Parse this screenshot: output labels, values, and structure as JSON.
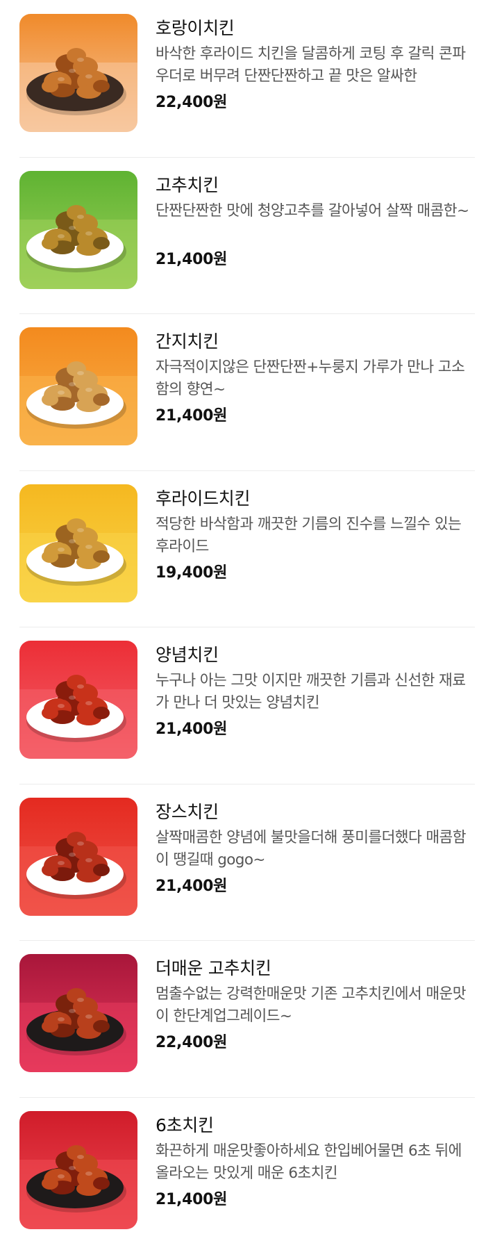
{
  "menu": {
    "items": [
      {
        "name": "호랑이치킨",
        "description": "바삭한 후라이드 치킨을 달콤하게 코팅 후 갈릭 콘파우더로 버무려 단짠단짠하고 끝 맛은 알싸한",
        "price": "22,400원",
        "image": {
          "icon": "chicken-photo",
          "bg_top": "#f08a2a",
          "bg_bottom": "#f7c8a0",
          "plate": "#3a2a22",
          "food": "#c9772e",
          "food_dark": "#9a4d17"
        }
      },
      {
        "name": "고추치킨",
        "description": "단짠단짠한 맛에 청양고추를 갈아넣어 살짝 매콤한~",
        "price": "21,400원",
        "image": {
          "icon": "chicken-photo",
          "bg_top": "#5fb332",
          "bg_bottom": "#9fd05a",
          "plate": "#ffffff",
          "food": "#b98a2c",
          "food_dark": "#7a5a18"
        }
      },
      {
        "name": "간지치킨",
        "description": "자극적이지않은 단짠단짠+누룽지 가루가 만나 고소함의 향연~",
        "price": "21,400원",
        "image": {
          "icon": "chicken-photo",
          "bg_top": "#f38a1e",
          "bg_bottom": "#f9b24a",
          "plate": "#ffffff",
          "food": "#d8a354",
          "food_dark": "#a5682a"
        }
      },
      {
        "name": "후라이드치킨",
        "description": "적당한 바삭함과 깨끗한 기름의 진수를 느낄수 있는 후라이드",
        "price": "19,400원",
        "image": {
          "icon": "chicken-photo",
          "bg_top": "#f5b820",
          "bg_bottom": "#f9d448",
          "plate": "#ffffff",
          "food": "#d19a3a",
          "food_dark": "#9c6420"
        }
      },
      {
        "name": "양념치킨",
        "description": "누구나 아는 그맛 이지만 깨끗한 기름과 신선한 재료가 만나 더 맛있는 양념치킨",
        "price": "21,400원",
        "image": {
          "icon": "chicken-photo",
          "bg_top": "#ec2e36",
          "bg_bottom": "#f4616a",
          "plate": "#ffffff",
          "food": "#c8321a",
          "food_dark": "#8a1c0c"
        }
      },
      {
        "name": "장스치킨",
        "description": "살짝매콤한 양념에 불맛을더해 풍미를더했다 매콤함이 땡길때 gogo~",
        "price": "21,400원",
        "image": {
          "icon": "chicken-photo",
          "bg_top": "#e42a20",
          "bg_bottom": "#f0544a",
          "plate": "#ffffff",
          "food": "#b8301a",
          "food_dark": "#7c1a0c"
        }
      },
      {
        "name": "더매운 고추치킨",
        "description": "멈출수없는 강력한매운맛 기존 고추치킨에서 매운맛이 한단계업그레이드~",
        "price": "22,400원",
        "image": {
          "icon": "chicken-photo",
          "bg_top": "#a8163a",
          "bg_bottom": "#e73a5c",
          "plate": "#1e1a1a",
          "food": "#b8401c",
          "food_dark": "#7a220c"
        }
      },
      {
        "name": "6초치킨",
        "description": "화끈하게 매운맛좋아하세요 한입베어물면 6초 뒤에 올라오는 맛있게 매운 6초치킨",
        "price": "21,400원",
        "image": {
          "icon": "chicken-photo",
          "bg_top": "#d01c2a",
          "bg_bottom": "#ef4a52",
          "plate": "#1e1a1a",
          "food": "#c04a1c",
          "food_dark": "#801e0c"
        }
      }
    ]
  }
}
